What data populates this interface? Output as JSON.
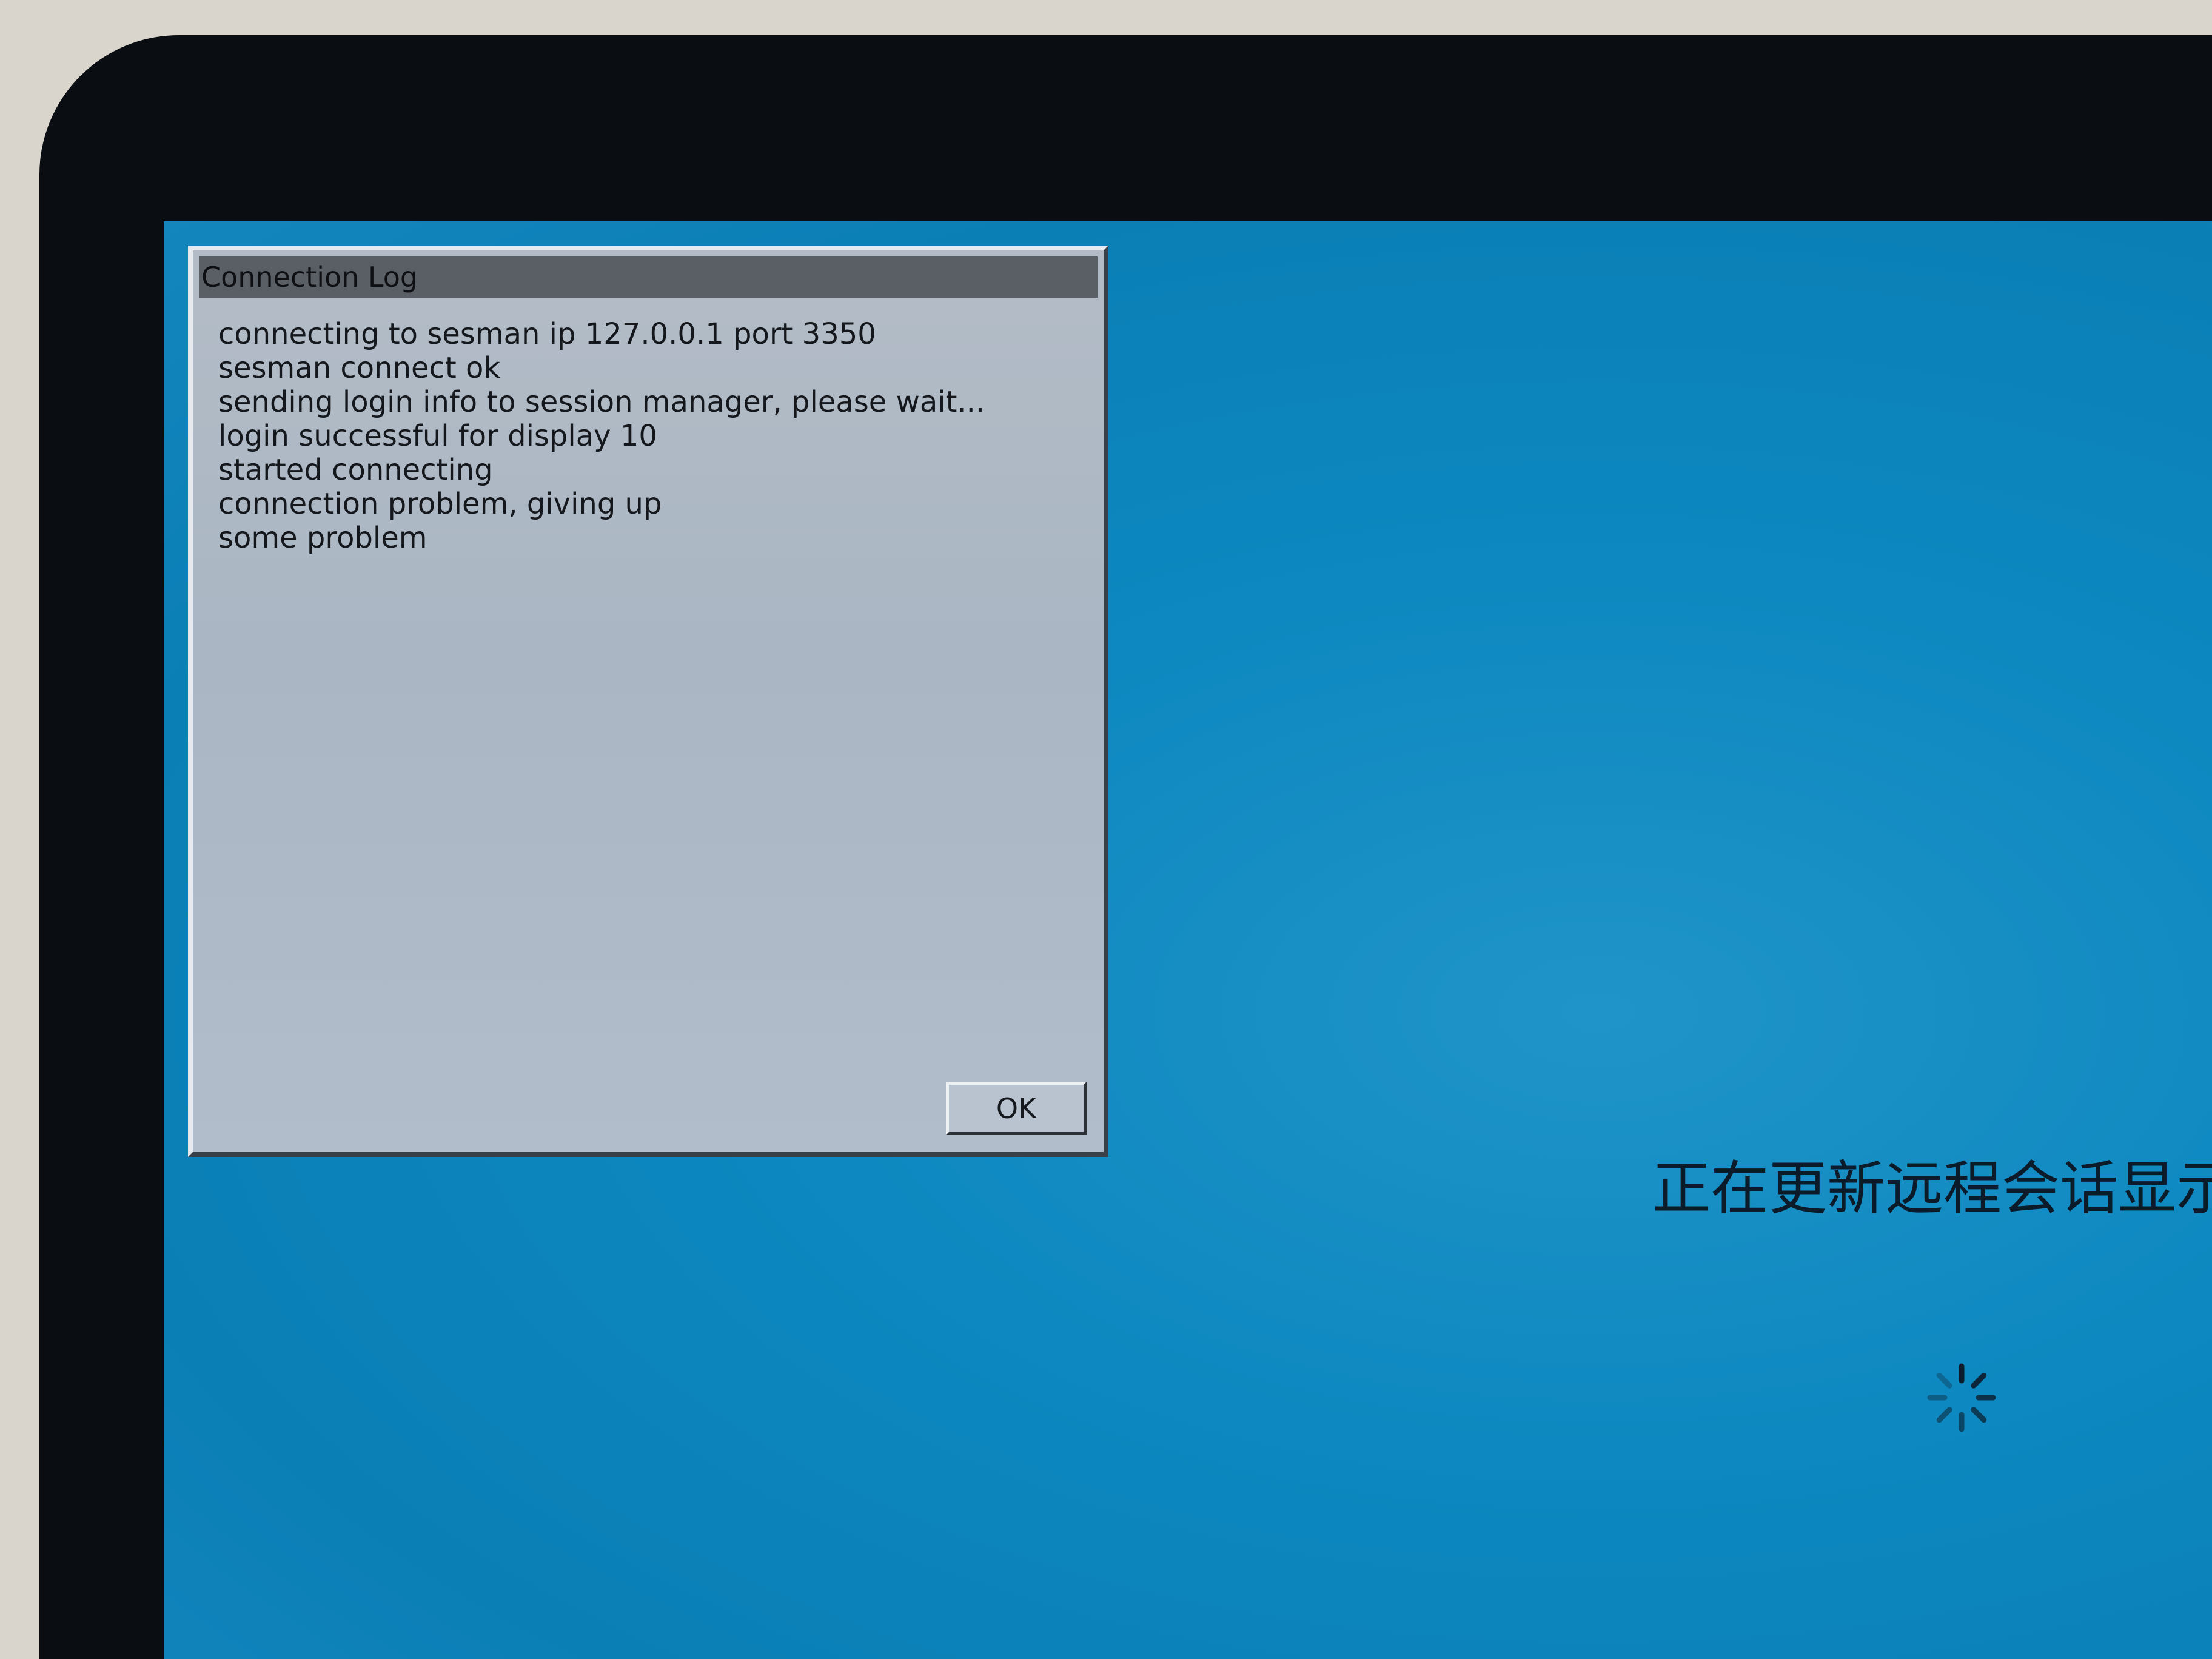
{
  "dialog": {
    "title": "Connection Log",
    "log_lines": [
      "connecting to sesman ip 127.0.0.1 port 3350",
      "sesman connect ok",
      "sending login info to session manager, please wait...",
      "login successful for display 10",
      "started connecting",
      "connection problem, giving up",
      "some problem"
    ],
    "ok_label": "OK"
  },
  "desktop": {
    "status_text": "正在更新远程会话显示",
    "spinner_icon": "loading-spinner-icon"
  },
  "colors": {
    "desktop_background": "#0d88c0",
    "dialog_background": "#aab6c4",
    "titlebar": "#5a5f66",
    "bezel": "#0a0d12"
  }
}
